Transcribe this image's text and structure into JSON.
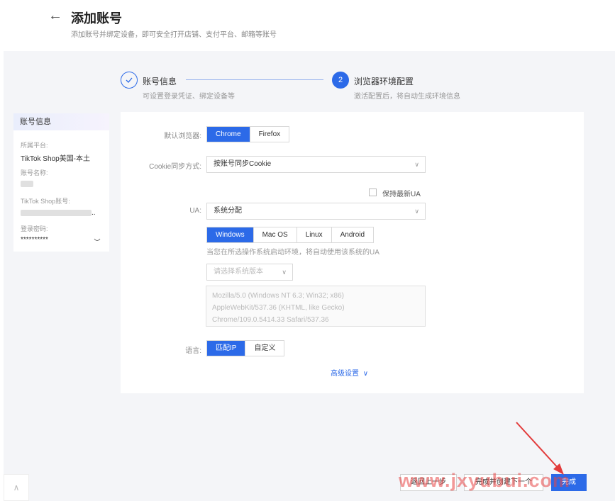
{
  "header": {
    "back_icon": "arrow-left-icon",
    "title": "添加账号",
    "subtitle": "添加账号并绑定设备，即可安全打开店铺、支付平台、邮箱等账号"
  },
  "steps": [
    {
      "icon": "check-icon",
      "label": "账号信息",
      "sub": "可设置登录凭证、绑定设备等"
    },
    {
      "number": "2",
      "label": "浏览器环境配置",
      "sub": "激活配置后，将自动生成环境信息"
    }
  ],
  "account_card": {
    "header": "账号信息",
    "platform_label": "所属平台:",
    "platform_value": "TikTok Shop美国-本土",
    "name_label": "账号名称:",
    "tiktok_label": "TikTok Shop账号:",
    "tiktok_value_suffix": "..",
    "password_label": "登录密码:",
    "password_value": "**********",
    "eye_icon": "eye-closed-icon"
  },
  "form": {
    "browser_label": "默认浏览器:",
    "browsers": [
      "Chrome",
      "Firefox"
    ],
    "cookie_label": "Cookie同步方式:",
    "cookie_value": "按账号同步Cookie",
    "keep_latest_ua": "保持最新UA",
    "ua_label": "UA:",
    "ua_value": "系统分配",
    "os_options": [
      "Windows",
      "Mac OS",
      "Linux",
      "Android"
    ],
    "os_hint": "当您在所选操作系统启动环境，将自动使用该系统的UA",
    "version_placeholder": "请选择系统版本",
    "ua_lines": [
      "Mozilla/5.0 (Windows NT 6.3; Win32; x86)",
      "AppleWebKit/537.36 (KHTML, like Gecko)",
      "Chrome/109.0.5414.33 Safari/537.36"
    ],
    "lang_label": "语言:",
    "lang_options": [
      "匹配IP",
      "自定义"
    ],
    "advanced": "高级设置"
  },
  "footer": {
    "back": "返回上一步",
    "finish_next": "完成并创建下一个",
    "finish": "完成"
  },
  "watermark": "www.jxyubui.com",
  "colors": {
    "primary": "#2c6ae8",
    "watermark": "#e84646",
    "background": "#f4f5f8"
  }
}
